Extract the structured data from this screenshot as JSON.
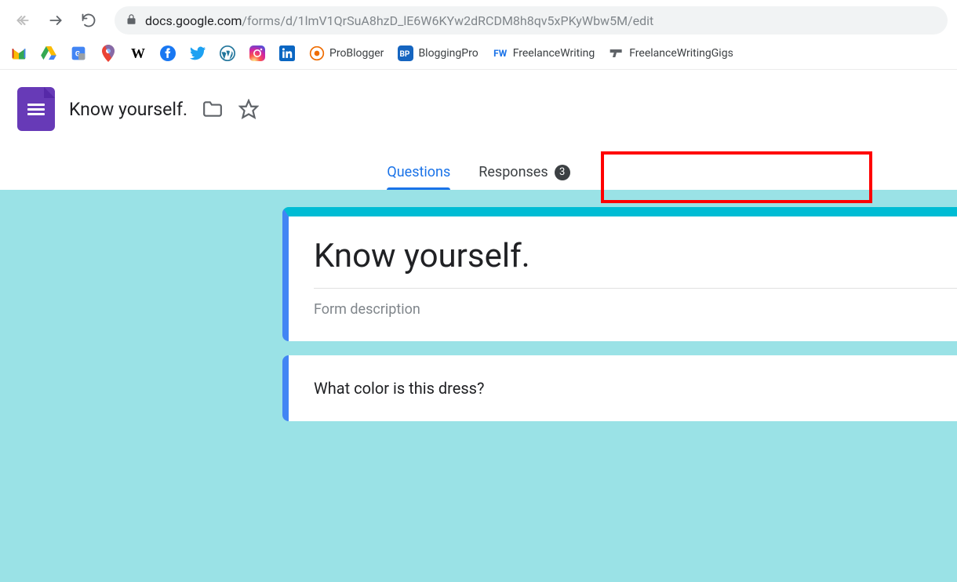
{
  "browser": {
    "url_host": "docs.google.com",
    "url_path": "/forms/d/1lmV1QrSuA8hzD_lE6W6KYw2dRCDM8h8qv5xPKyWbw5M/edit"
  },
  "bookmarks": {
    "problogger": "ProBlogger",
    "bloggingpro": "BloggingPro",
    "freelancewriting": "FreelanceWriting",
    "freelancewritinggigs": "FreelanceWritingGigs",
    "fw_label": "FW",
    "bp_label": "BP"
  },
  "header": {
    "form_name": "Know yourself."
  },
  "tabs": {
    "questions": "Questions",
    "responses": "Responses",
    "responses_count": "3"
  },
  "form": {
    "title": "Know yourself.",
    "description_placeholder": "Form description",
    "question1": "What color is this dress?"
  }
}
